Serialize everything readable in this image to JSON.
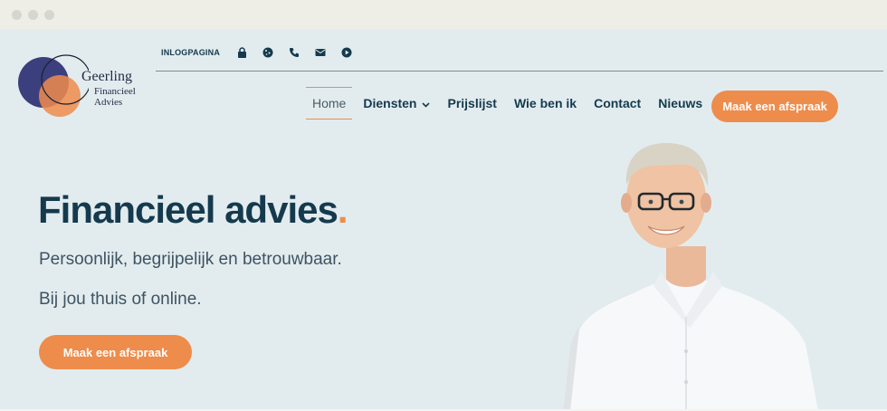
{
  "browser": {
    "window_controls": [
      "close",
      "minimize",
      "maximize"
    ]
  },
  "logo": {
    "line1": "Geerling",
    "line2": "Financieel",
    "line3": "Advies",
    "colors": {
      "indigo": "#3c3f7d",
      "orange": "#ee8c4c"
    }
  },
  "utility": {
    "login_label": "INLOGPAGINA",
    "icons": [
      "lock-icon",
      "cookie-icon",
      "phone-icon",
      "mail-icon",
      "play-icon"
    ]
  },
  "nav": {
    "items": [
      {
        "label": "Home",
        "active": true
      },
      {
        "label": "Diensten",
        "has_dropdown": true
      },
      {
        "label": "Prijslijst"
      },
      {
        "label": "Wie ben ik"
      },
      {
        "label": "Contact"
      },
      {
        "label": "Nieuws"
      }
    ],
    "cta_label": "Maak een afspraak"
  },
  "hero": {
    "title": "Financieel advies",
    "title_accent": ".",
    "subtitle1": "Persoonlijk, begrijpelijk en betrouwbaar.",
    "subtitle2": "Bij jou thuis of online.",
    "cta_label": "Maak een afspraak"
  },
  "colors": {
    "background": "#e2ecef",
    "text_dark": "#153a4d",
    "accent": "#ee8c4c",
    "muted_text": "#3f5361"
  }
}
